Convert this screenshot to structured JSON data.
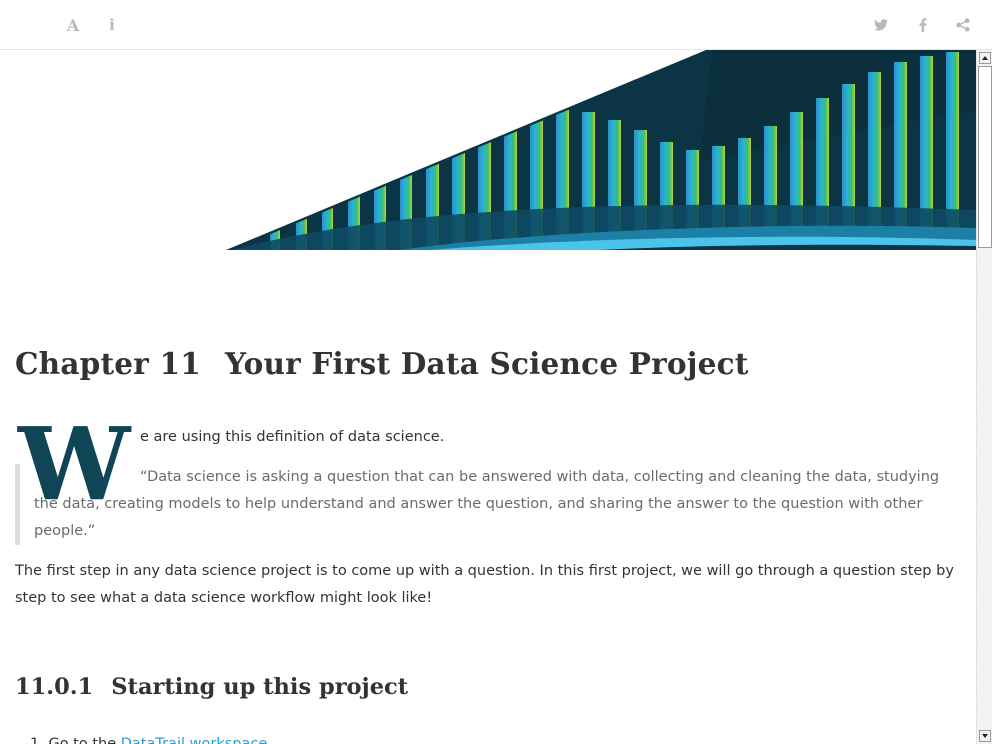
{
  "toolbar": {
    "font_icon_glyph": "A",
    "info_icon_glyph": "i",
    "icons": [
      "font-settings-icon",
      "info-icon",
      "twitter-icon",
      "facebook-icon",
      "share-icon"
    ]
  },
  "chapter": {
    "number": "Chapter 11",
    "title": "Your First Data Science Project"
  },
  "intro": {
    "dropcap": "W",
    "rest": "e are using this definition of data science."
  },
  "quote": "“Data science is asking a question that can be answered with data, collecting and cleaning the data, studying the data, creating models to help understand and answer the question, and sharing the answer to the question with other people.”",
  "paragraph": "The first step in any data science project is to come up with a question. In this first project, we will go through a question step by step to see what a data science workflow might look like!",
  "section": {
    "number": "11.0.1",
    "title": "Starting up this project"
  },
  "list": [
    {
      "marker": "1.",
      "prefix": "Go to the ",
      "link": "DataTrail workspace"
    }
  ],
  "colors": {
    "dropcap": "#0f4555",
    "link": "#2b9cd0",
    "banner_dark": "#0b3445"
  }
}
